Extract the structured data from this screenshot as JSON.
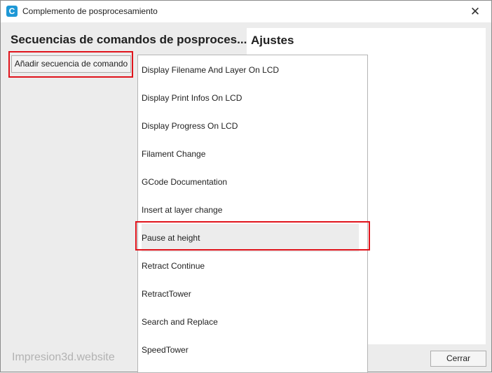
{
  "window": {
    "title": "Complemento de posprocesamiento",
    "close_glyph": "✕",
    "app_icon_glyph": "C"
  },
  "left_panel": {
    "heading": "Secuencias de comandos de posproces...",
    "add_button_label": "Añadir secuencia de comando"
  },
  "settings_panel": {
    "heading": "Ajustes"
  },
  "dropdown": {
    "items": [
      {
        "label": "Display Filename And Layer On LCD"
      },
      {
        "label": "Display Print Infos On LCD"
      },
      {
        "label": "Display Progress On LCD"
      },
      {
        "label": "Filament Change"
      },
      {
        "label": "GCode Documentation"
      },
      {
        "label": "Insert at layer change"
      },
      {
        "label": "Pause at height"
      },
      {
        "label": "Retract Continue"
      },
      {
        "label": "RetractTower"
      },
      {
        "label": "Search and Replace"
      },
      {
        "label": "SpeedTower"
      }
    ],
    "selected_label": "Pause at height"
  },
  "footer": {
    "watermark": "Impresion3d.website",
    "close_button_label": "Cerrar"
  },
  "colors": {
    "highlight": "#e0141c",
    "app_icon": "#1e98d6"
  },
  "icons": {
    "app": "cura-app-icon",
    "close": "close-icon"
  }
}
